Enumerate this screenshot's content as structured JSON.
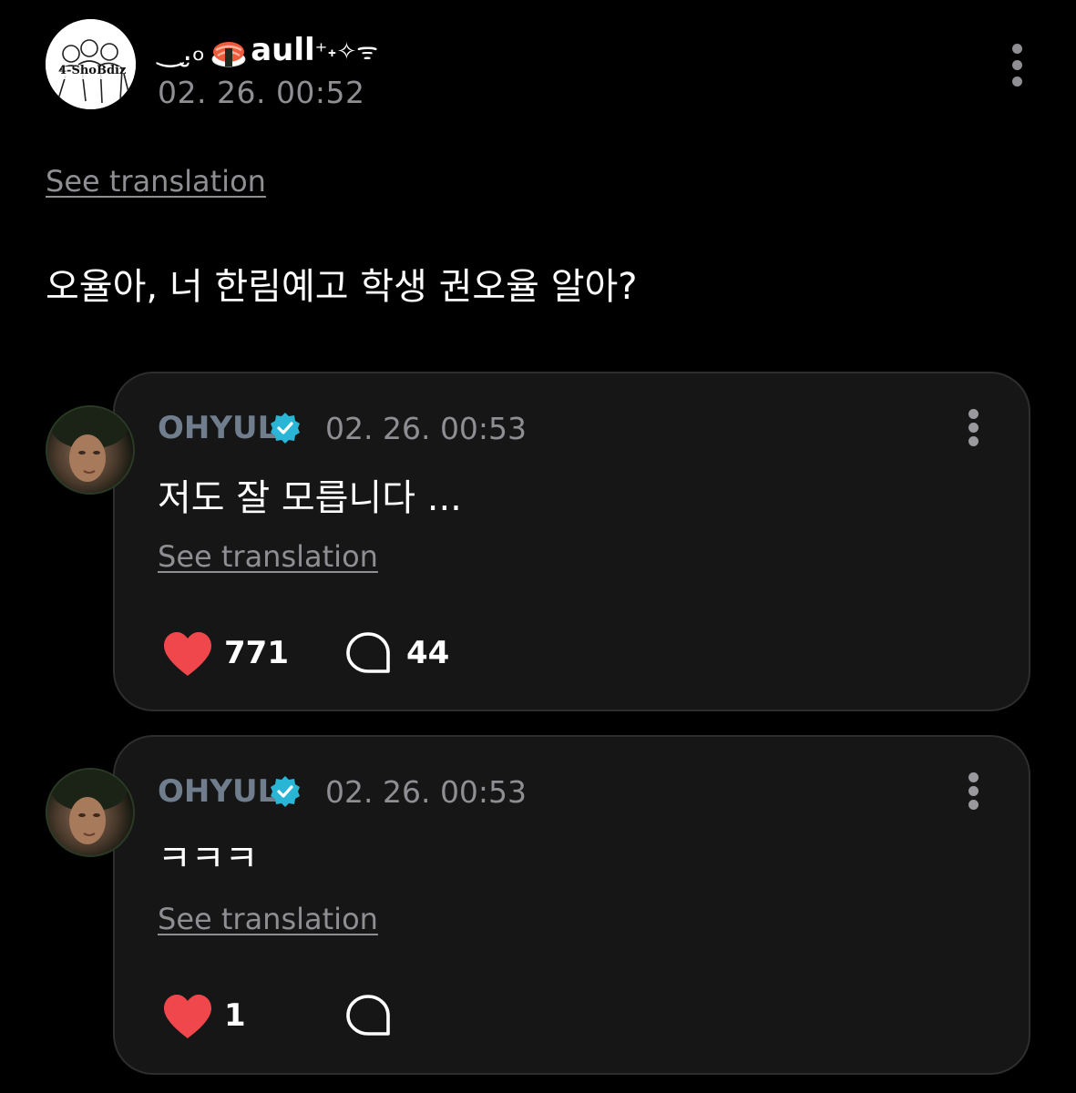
{
  "post": {
    "username_prefix": "‿.̮ₒ",
    "username": "aull",
    "username_suffix": "⁺˖✧ᯤ",
    "timestamp": "02. 26. 00:52",
    "avatar_text": "4-ShoBdiz",
    "see_translation": "See translation",
    "body": "오율아, 너 한림예고 학생 권오율 알아?"
  },
  "replies": [
    {
      "name": "OHYUL",
      "timestamp": "02. 26. 00:53",
      "text": "저도 잘 모릅니다 ...",
      "see_translation": "See translation",
      "likes": "771",
      "comments": "44"
    },
    {
      "name": "OHYUL",
      "timestamp": "02. 26. 00:53",
      "text": "ㅋㅋㅋ",
      "see_translation": "See translation",
      "likes": "1",
      "comments": ""
    }
  ],
  "colors": {
    "background": "#000000",
    "card": "#161616",
    "muted": "#8e8e93",
    "name": "#707d8c",
    "verified": "#29b6d6",
    "heart": "#f0474c"
  },
  "icons": [
    "more-vertical-icon",
    "verified-badge-icon",
    "heart-icon",
    "comment-bubble-icon",
    "sushi-emoji-icon"
  ]
}
